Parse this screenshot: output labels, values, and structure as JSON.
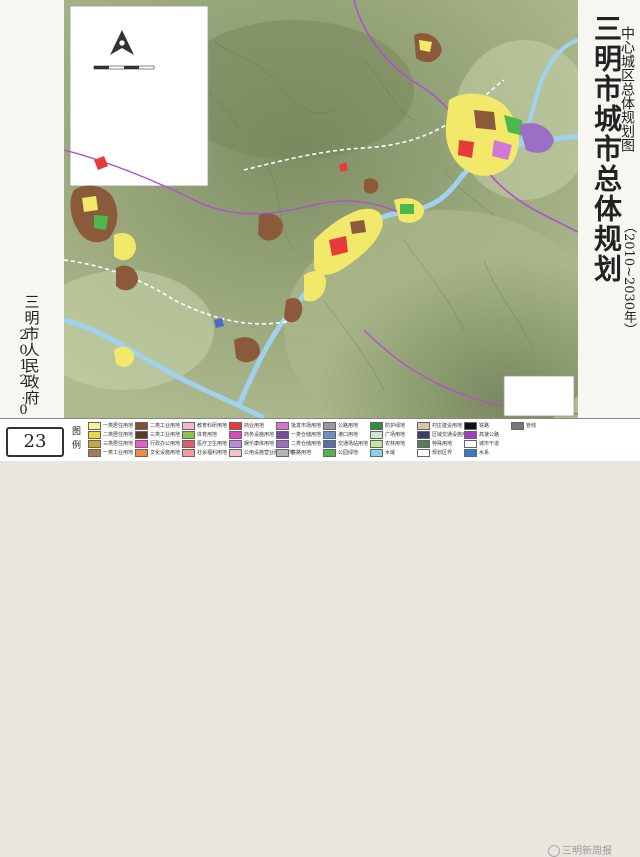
{
  "title": "三明市城市总体规划",
  "subtitle": "中心城区总体规划图",
  "years": "（2010~2030年）",
  "issuer": "三明市人民政府",
  "date": "2012.08",
  "page_number": "23",
  "legend": {
    "label": "图例",
    "items": [
      {
        "label": "一类居住用地",
        "color": "#f6f18a"
      },
      {
        "label": "二类居住用地",
        "color": "#e8d84a"
      },
      {
        "label": "三类居住用地",
        "color": "#c9a73d"
      },
      {
        "label": "一类工业用地",
        "color": "#a87b4b"
      },
      {
        "label": "二类工业用地",
        "color": "#7b5236"
      },
      {
        "label": "三类工业用地",
        "color": "#5a3a23"
      },
      {
        "label": "行政办公用地",
        "color": "#ec5bd2"
      },
      {
        "label": "文化设施用地",
        "color": "#f08a4a"
      },
      {
        "label": "教育科研用地",
        "color": "#f4b6d4"
      },
      {
        "label": "体育用地",
        "color": "#8ac24a"
      },
      {
        "label": "医疗卫生用地",
        "color": "#e85a6c"
      },
      {
        "label": "社会福利用地",
        "color": "#f29c9c"
      },
      {
        "label": "商业用地",
        "color": "#e83a3a"
      },
      {
        "label": "商务设施用地",
        "color": "#d94ab8"
      },
      {
        "label": "娱乐康体用地",
        "color": "#b98ae0"
      },
      {
        "label": "公用设施营业网点用地",
        "color": "#f7c4c4"
      },
      {
        "label": "批发市场用地",
        "color": "#cf76d8"
      },
      {
        "label": "一类仓储用地",
        "color": "#7a4aa0"
      },
      {
        "label": "二类仓储用地",
        "color": "#9b6fc6"
      },
      {
        "label": "铁路用地",
        "color": "#b4b4b4"
      },
      {
        "label": "公路用地",
        "color": "#9a9a9a"
      },
      {
        "label": "港口用地",
        "color": "#6f8fc9"
      },
      {
        "label": "交通场站用地",
        "color": "#5a6eb4"
      },
      {
        "label": "公园绿地",
        "color": "#4cb84c"
      },
      {
        "label": "防护绿地",
        "color": "#2f8f3a"
      },
      {
        "label": "广场用地",
        "color": "#cfe6cf"
      },
      {
        "label": "农林用地",
        "color": "#c6e3a3"
      },
      {
        "label": "水域",
        "color": "#8fd0ef"
      },
      {
        "label": "村庄建设用地",
        "color": "#d8c6a8"
      },
      {
        "label": "区域交通设施用地",
        "color": "#3d3d6b"
      },
      {
        "label": "特殊用地",
        "color": "#5a7a5a"
      },
      {
        "label": "规划区界",
        "color": "#ffffff"
      },
      {
        "label": "铁路",
        "color": "#111111"
      },
      {
        "label": "高速公路",
        "color": "#a040c0"
      },
      {
        "label": "城市干道",
        "color": "#ffffff"
      },
      {
        "label": "水系",
        "color": "#3b78c8"
      },
      {
        "label": "管线",
        "color": "#777777"
      }
    ]
  },
  "watermark": "三明新周报",
  "colors": {
    "terrain_low": "#b8c49a",
    "terrain_high": "#6f7f55",
    "river": "#a9d9f3",
    "highway": "#b040d0",
    "residential": "#f6f18a",
    "industrial": "#8a5a3a",
    "green": "#4cb84c"
  }
}
